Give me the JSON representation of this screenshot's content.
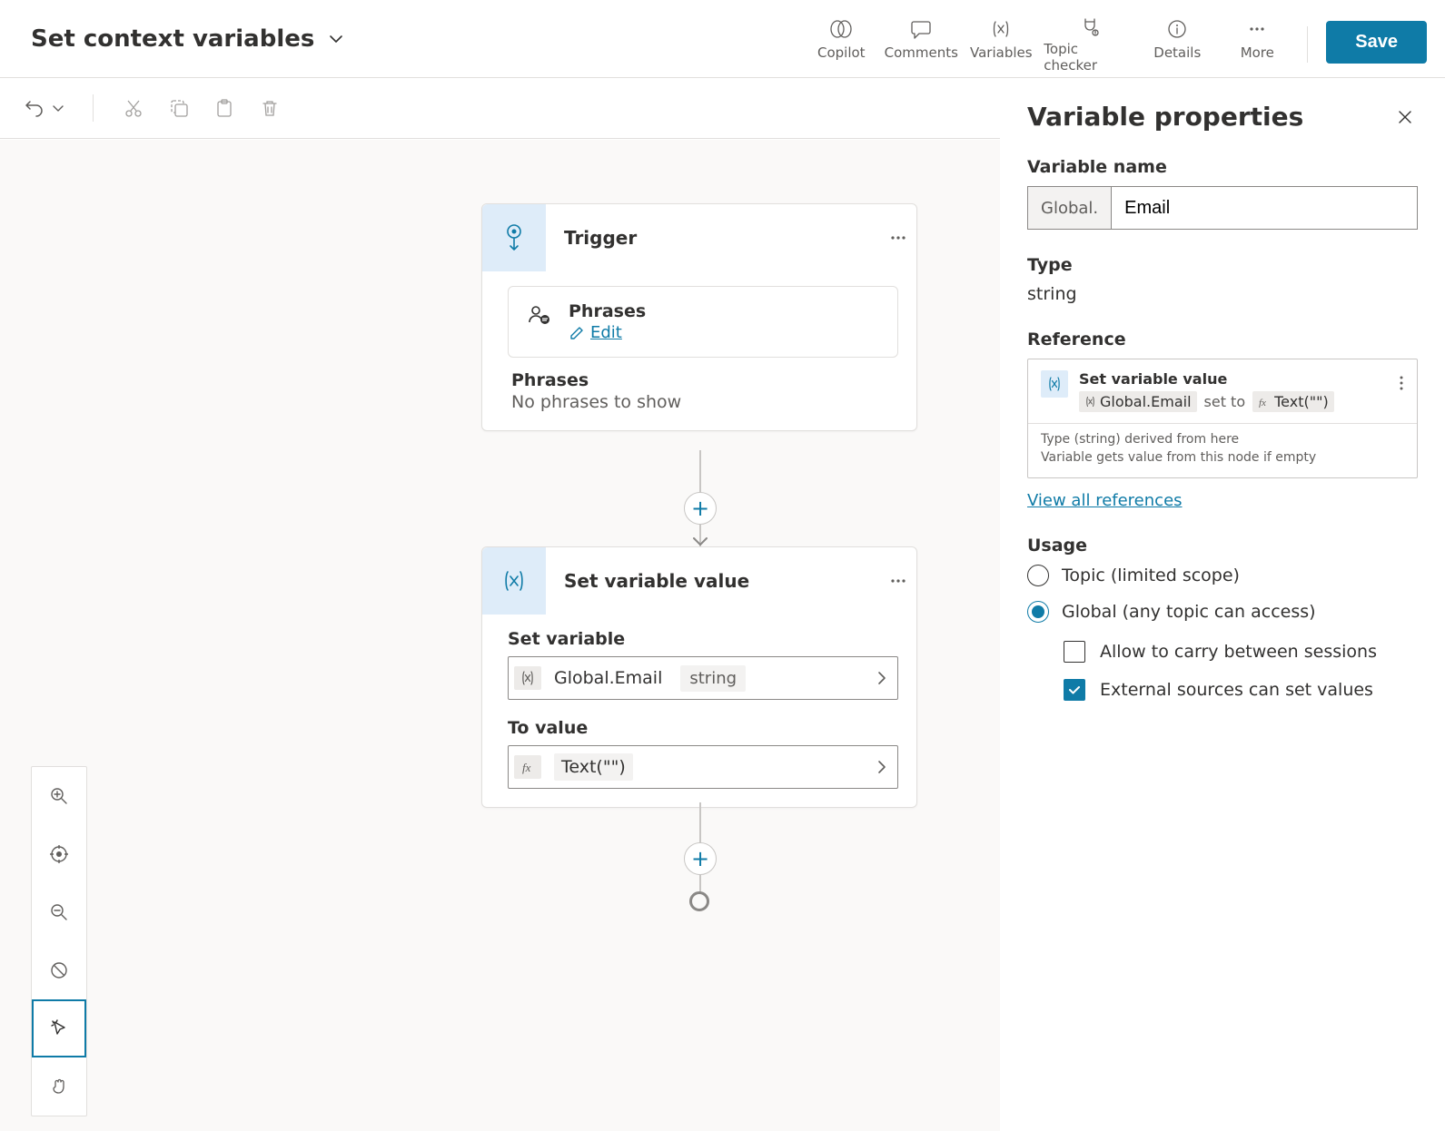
{
  "header": {
    "title": "Set context variables",
    "tools": {
      "copilot": "Copilot",
      "comments": "Comments",
      "variables": "Variables",
      "topic_checker": "Topic checker",
      "details": "Details",
      "more": "More"
    },
    "save": "Save"
  },
  "canvas": {
    "trigger": {
      "title": "Trigger",
      "phrases_card_title": "Phrases",
      "edit": "Edit",
      "phrases_label": "Phrases",
      "phrases_empty": "No phrases to show"
    },
    "setvar": {
      "title": "Set variable value",
      "set_label": "Set variable",
      "variable_name": "Global.Email",
      "variable_type": "string",
      "to_label": "To value",
      "to_value": "Text(\"\")"
    }
  },
  "panel": {
    "title": "Variable properties",
    "name_label": "Variable name",
    "name_prefix": "Global.",
    "name_value": "Email",
    "type_label": "Type",
    "type_value": "string",
    "reference_label": "Reference",
    "ref_title": "Set variable value",
    "ref_var": "Global.Email",
    "ref_setto": "set to",
    "ref_expr": "Text(\"\")",
    "ref_sub1": "Type (string) derived from here",
    "ref_sub2": "Variable gets value from this node if empty",
    "view_all": "View all references",
    "usage_label": "Usage",
    "usage_topic": "Topic (limited scope)",
    "usage_global": "Global (any topic can access)",
    "check_carry": "Allow to carry between sessions",
    "check_external": "External sources can set values"
  }
}
